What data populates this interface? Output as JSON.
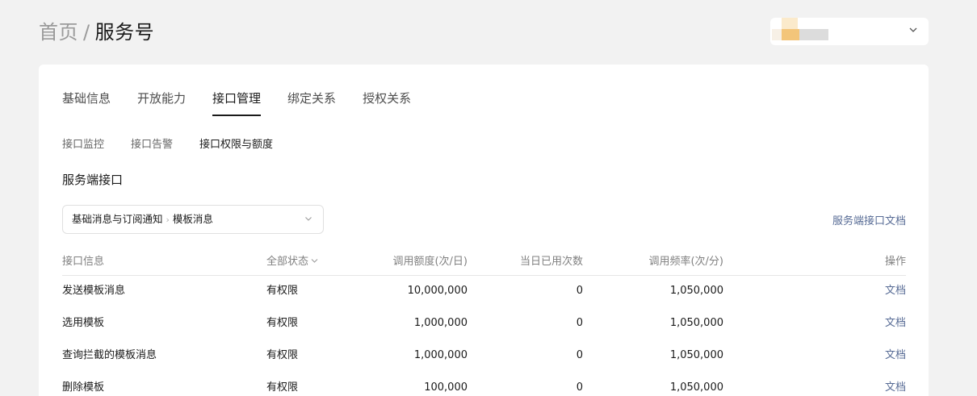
{
  "breadcrumb": {
    "home": "首页",
    "separator": "/",
    "current": "服务号"
  },
  "account": {
    "chevron_icon": "chevron-down-icon"
  },
  "tabs": [
    {
      "label": "基础信息",
      "active": false
    },
    {
      "label": "开放能力",
      "active": false
    },
    {
      "label": "接口管理",
      "active": true
    },
    {
      "label": "绑定关系",
      "active": false
    },
    {
      "label": "授权关系",
      "active": false
    }
  ],
  "subtabs": [
    {
      "label": "接口监控",
      "active": false
    },
    {
      "label": "接口告警",
      "active": false
    },
    {
      "label": "接口权限与额度",
      "active": true
    }
  ],
  "section_title": "服务端接口",
  "selector": {
    "category": "基础消息与订阅通知",
    "separator": "›",
    "subcategory": "模板消息"
  },
  "doc_link": "服务端接口文档",
  "table": {
    "headers": {
      "name": "接口信息",
      "status": "全部状态",
      "quota": "调用额度(次/日)",
      "used": "当日已用次数",
      "freq": "调用频率(次/分)",
      "op": "操作"
    },
    "rows": [
      {
        "name": "发送模板消息",
        "status": "有权限",
        "quota": "10,000,000",
        "used": "0",
        "freq": "1,050,000",
        "op": "文档"
      },
      {
        "name": "选用模板",
        "status": "有权限",
        "quota": "1,000,000",
        "used": "0",
        "freq": "1,050,000",
        "op": "文档"
      },
      {
        "name": "查询拦截的模板消息",
        "status": "有权限",
        "quota": "1,000,000",
        "used": "0",
        "freq": "1,050,000",
        "op": "文档"
      },
      {
        "name": "删除模板",
        "status": "有权限",
        "quota": "100,000",
        "used": "0",
        "freq": "1,050,000",
        "op": "文档"
      }
    ]
  }
}
